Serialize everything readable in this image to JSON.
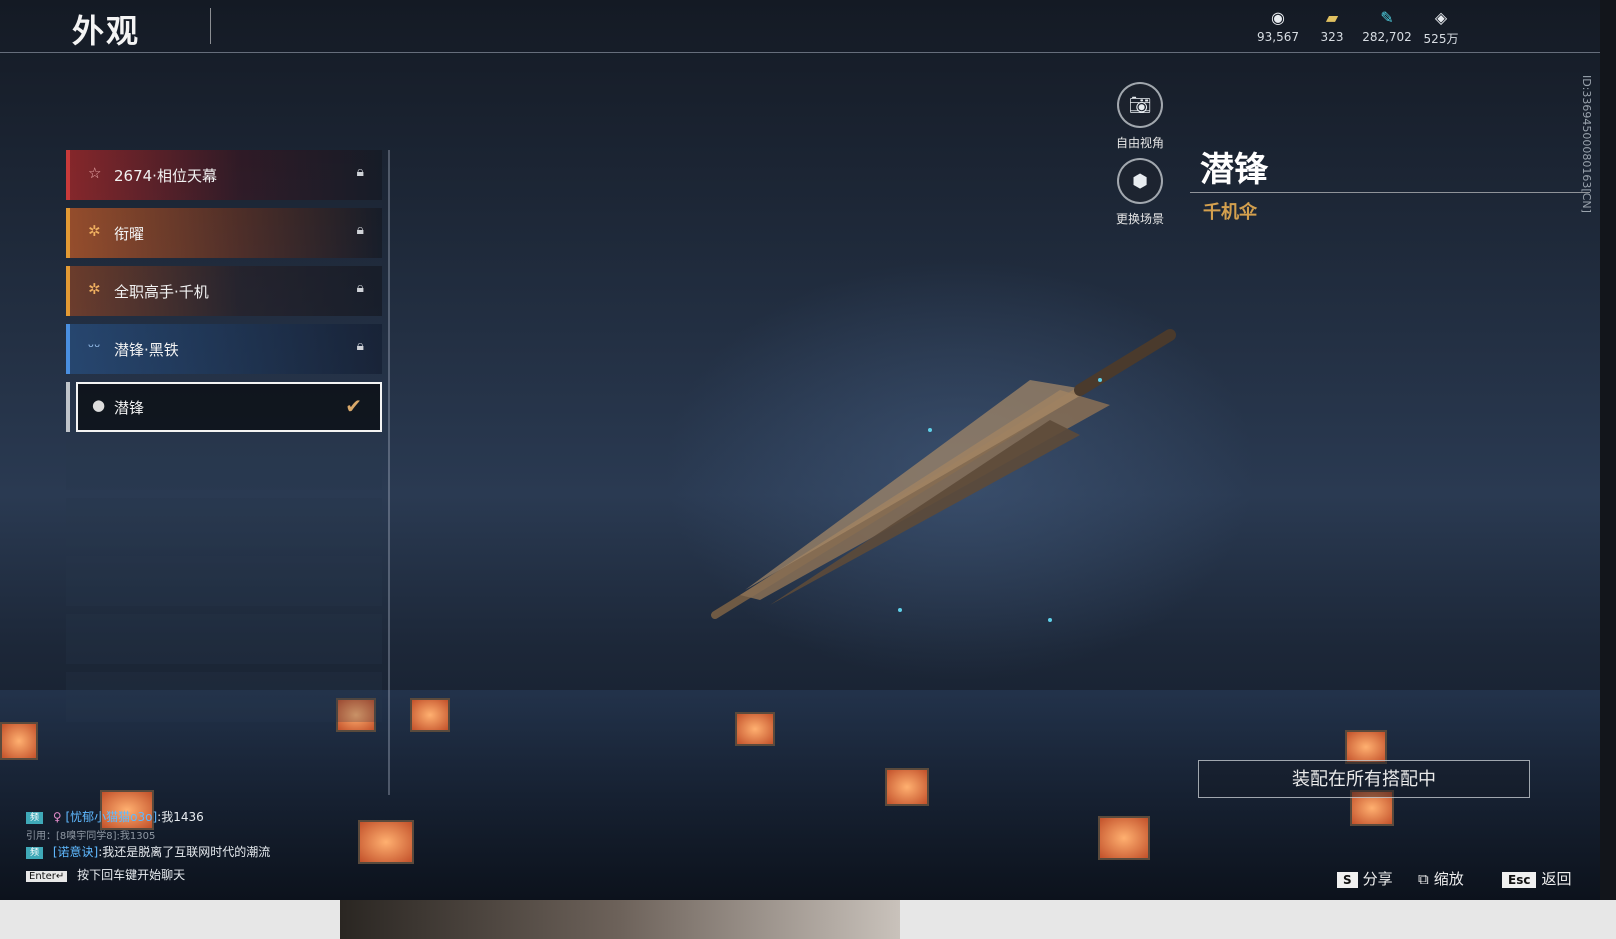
{
  "header": {
    "title": "外观",
    "currencies": [
      {
        "icon": "coin-icon",
        "value": "93,567"
      },
      {
        "icon": "ticket-icon",
        "value": "323"
      },
      {
        "icon": "feather-icon",
        "value": "282,702"
      },
      {
        "icon": "diamond-icon",
        "value": "525万"
      }
    ]
  },
  "list": {
    "items": [
      {
        "label": "2674·相位天幕",
        "icon": "star-outline-icon",
        "accent": "#c83a3a",
        "locked": true
      },
      {
        "label": "衔曜",
        "icon": "flower-icon",
        "accent": "#e39a34",
        "locked": true
      },
      {
        "label": "全职高手·千机",
        "icon": "flower-icon",
        "accent": "#e39a34",
        "locked": true
      },
      {
        "label": "潜锋·黑铁",
        "icon": "wings-icon",
        "accent": "#4a8fe0",
        "locked": true
      },
      {
        "label": "潜锋",
        "icon": "drop-icon",
        "accent": "#bfc4ca",
        "locked": false,
        "selected": true
      }
    ]
  },
  "controls": {
    "free_view": "自由视角",
    "change_scene": "更换场景"
  },
  "detail": {
    "title": "潜锋",
    "subtitle": "千机伞",
    "id": "ID:3369450008016​3[CN]",
    "equip_button": "装配在所有搭配中"
  },
  "chat": {
    "line1_name": "[忧郁小猫猫o3o]",
    "line1_text": ":我1436",
    "line2_quote": "引用：[8嗅宇同学8]:我1305",
    "line3_name": "[诺意诀]",
    "line3_text": ":我还是脱离了互联网时代的潮流",
    "enter_key": "Enter↵",
    "prompt": "按下回车键开始聊天",
    "tag": "频"
  },
  "hints": {
    "share_key": "S",
    "share": "分享",
    "zoom": "缩放",
    "back_key": "Esc",
    "back": "返回"
  },
  "colors": {
    "gold": "#d4a04e",
    "cyan": "#5fb9ff"
  }
}
